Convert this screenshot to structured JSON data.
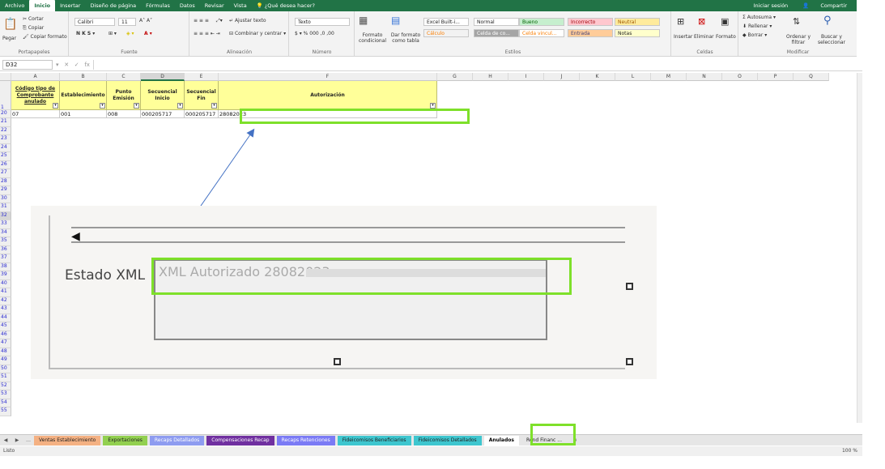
{
  "menu": {
    "tabs": [
      "Archivo",
      "Inicio",
      "Insertar",
      "Diseño de página",
      "Fórmulas",
      "Datos",
      "Revisar",
      "Vista"
    ],
    "active": "Inicio",
    "tell_me": "¿Qué desea hacer?",
    "signin": "Iniciar sesión",
    "share": "Compartir"
  },
  "ribbon": {
    "clipboard": {
      "cut": "Cortar",
      "copy": "Copiar",
      "paste": "Pegar",
      "format_painter": "Copiar formato",
      "label": "Portapapeles"
    },
    "font": {
      "name": "Calibri",
      "size": "11",
      "label": "Fuente"
    },
    "alignment": {
      "wrap": "Ajustar texto",
      "merge": "Combinar y centrar",
      "label": "Alineación"
    },
    "number": {
      "format": "Texto",
      "label": "Número"
    },
    "styles": {
      "cond_format": "Formato condicional",
      "as_table": "Dar formato como tabla",
      "label": "Estilos",
      "cells": [
        {
          "text": "Excel Built-i...",
          "bg": "#ffffff",
          "fg": "#222222"
        },
        {
          "text": "Normal",
          "bg": "#ffffff",
          "fg": "#222222"
        },
        {
          "text": "Bueno",
          "bg": "#c6efce",
          "fg": "#006100"
        },
        {
          "text": "Incorrecto",
          "bg": "#ffc7ce",
          "fg": "#9c0006"
        },
        {
          "text": "Neutral",
          "bg": "#ffeb9c",
          "fg": "#9c5700"
        },
        {
          "text": "Cálculo",
          "bg": "#f2f2f2",
          "fg": "#fa7d00"
        },
        {
          "text": "Celda de co...",
          "bg": "#a5a5a5",
          "fg": "#ffffff"
        },
        {
          "text": "Celda vincul...",
          "bg": "#ffffff",
          "fg": "#fa7d00"
        },
        {
          "text": "Entrada",
          "bg": "#ffcc99",
          "fg": "#3f3f76"
        },
        {
          "text": "Notas",
          "bg": "#ffffcc",
          "fg": "#222222"
        }
      ]
    },
    "cells": {
      "insert": "Insertar",
      "delete": "Eliminar",
      "format": "Formato",
      "label": "Celdas"
    },
    "editing": {
      "autosum": "Autosuma",
      "fill": "Rellenar",
      "clear": "Borrar",
      "sort": "Ordenar y filtrar",
      "find": "Buscar y seleccionar",
      "label": "Modificar"
    }
  },
  "formula_bar": {
    "name_box": "D32",
    "fx": "fx",
    "value": ""
  },
  "grid": {
    "columns": [
      "A",
      "B",
      "C",
      "D",
      "E",
      "F",
      "G",
      "H",
      "I",
      "J",
      "K",
      "L",
      "M",
      "N",
      "O",
      "P",
      "Q"
    ],
    "header_row_number": "1",
    "headers": [
      "Código tipo de Comprobante anulado",
      "Establecimiento",
      "Punto Emisión",
      "Secuencial Inicio",
      "Secuencial Fin",
      "Autorización"
    ],
    "data_row_number": "20",
    "data": [
      "07",
      "001",
      "008",
      "000205717",
      "000205717",
      "28082023"
    ],
    "row_numbers": [
      "21",
      "22",
      "23",
      "24",
      "25",
      "26",
      "27",
      "28",
      "29",
      "30",
      "31",
      "32",
      "33",
      "34",
      "35",
      "36",
      "37",
      "38",
      "39",
      "40",
      "41",
      "42",
      "43",
      "44",
      "45",
      "46",
      "47",
      "48",
      "49",
      "50",
      "51",
      "52",
      "53",
      "54",
      "55"
    ]
  },
  "inset": {
    "label": "Estado XML",
    "value": "XML Autorizado 28082023"
  },
  "sheet_tabs": [
    {
      "name": "Ventas Establecimiento",
      "color": "#f4b183"
    },
    {
      "name": "Exportaciones",
      "color": "#92d050"
    },
    {
      "name": "Recaps Detallados",
      "color": "#8e9cf0"
    },
    {
      "name": "Compensaciones Recap",
      "color": "#7030a0"
    },
    {
      "name": "Recaps Retenciones",
      "color": "#7b7bf5"
    },
    {
      "name": "Fideicomisos Beneficiarios",
      "color": "#3ec6cf"
    },
    {
      "name": "Fideicomisos Detallados",
      "color": "#3ec6cf"
    },
    {
      "name": "Anulados",
      "color": "#ffffff"
    },
    {
      "name": "Rend Financ ...",
      "color": "#e6e6e6"
    }
  ],
  "status": {
    "ready": "Listo",
    "zoom": "100 %"
  }
}
